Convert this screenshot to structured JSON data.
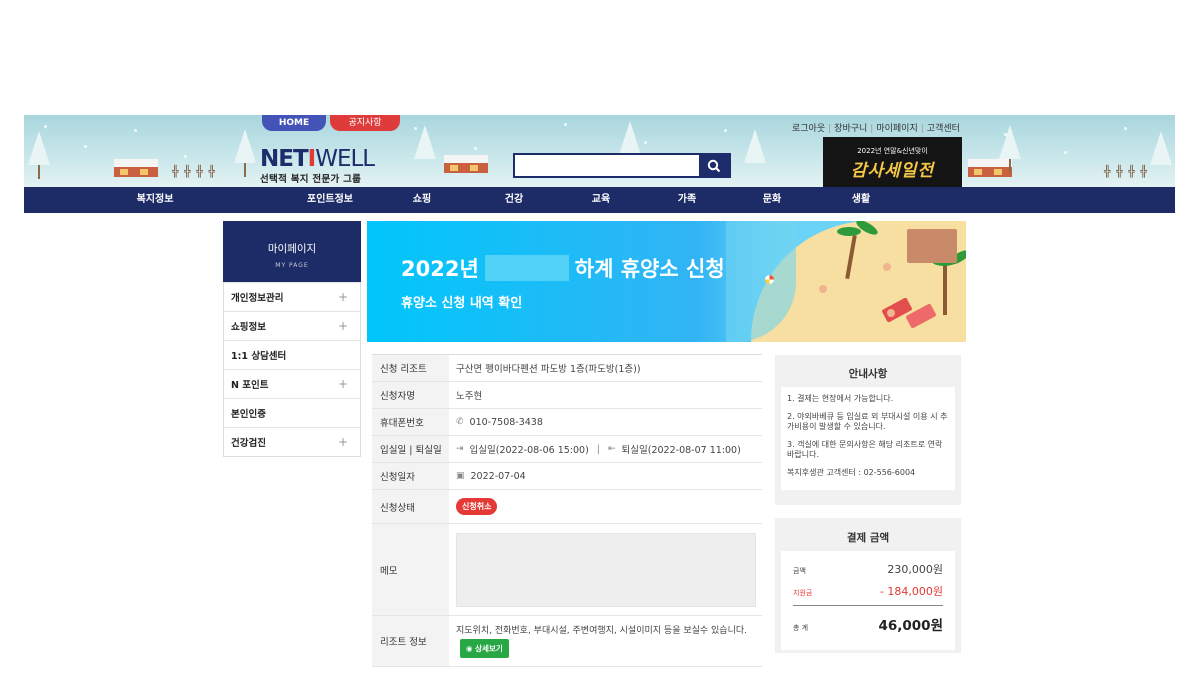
{
  "header": {
    "top_nav": {
      "home": "HOME",
      "notice": "공지사항"
    },
    "logo": {
      "net": "NET",
      "i": "I",
      "well": "WELL",
      "tagline": "선택적 복지 전문가 그룹"
    },
    "search": {
      "value": "",
      "placeholder": ""
    },
    "util_links": [
      "로그아웃",
      "장바구니",
      "마이페이지",
      "고객센터"
    ],
    "ad_banner": {
      "subtitle": "2022년 연말&신년맞이",
      "title": "감사세일전"
    }
  },
  "gnb": [
    "복지정보",
    "포인트정보",
    "쇼핑",
    "건강",
    "교육",
    "가족",
    "문화",
    "생활"
  ],
  "sidebar": {
    "title": "마이페이지",
    "subtitle": "MY PAGE",
    "items": [
      {
        "label": "개인정보관리",
        "expandable": true
      },
      {
        "label": "쇼핑정보",
        "expandable": true
      },
      {
        "label": "1:1 상담센터",
        "expandable": false
      },
      {
        "label": "N 포인트",
        "expandable": true
      },
      {
        "label": "본인인증",
        "expandable": false
      },
      {
        "label": "건강검진",
        "expandable": true
      }
    ]
  },
  "hero": {
    "title_prefix": "2022년",
    "title_suffix": "하계 휴양소 신청",
    "subtitle": "휴양소 신청 내역 확인"
  },
  "detail": {
    "resort_label": "신청 리조트",
    "resort_value": "구산면 펭이바다펜션 파도방 1층(파도방(1층))",
    "name_label": "신청자명",
    "name_value": "노주현",
    "phone_label": "휴대폰번호",
    "phone_value": "010-7508-3438",
    "dates_label": "입실일 | 퇴실일",
    "checkin_value": "입실일(2022-08-06 15:00)",
    "date_sep": "|",
    "checkout_value": "퇴실일(2022-08-07 11:00)",
    "applied_label": "신청일자",
    "applied_value": "2022-07-04",
    "status_label": "신청상태",
    "status_value": "신청취소",
    "memo_label": "메모",
    "memo_value": "",
    "info_label": "리조트 정보",
    "info_value": "지도위치, 전화번호, 부대시설, 주변여행지, 시설이미지 등을 보실수 있습니다.",
    "info_button": "상세보기"
  },
  "notice": {
    "title": "안내사항",
    "items": [
      "1. 결제는 현장에서 가능합니다.",
      "2. 야외바베큐 등 입실료 외 부대시설 이용 시 추가비용이 발생할 수 있습니다.",
      "3. 객실에 대한 문의사항은 해당 리조트로 연락바랍니다.",
      "복지후생관 고객센터 : 02-556-6004"
    ]
  },
  "payment": {
    "title": "결제 금액",
    "amount_label": "금액",
    "amount_value": "230,000원",
    "subsidy_label": "지원금",
    "subsidy_value": "- 184,000원",
    "total_label": "총 계",
    "total_value": "46,000원"
  },
  "colors": {
    "navy": "#1d2b66",
    "hero_blue": "#00c6fb",
    "red": "#e53935",
    "green": "#28a745"
  }
}
